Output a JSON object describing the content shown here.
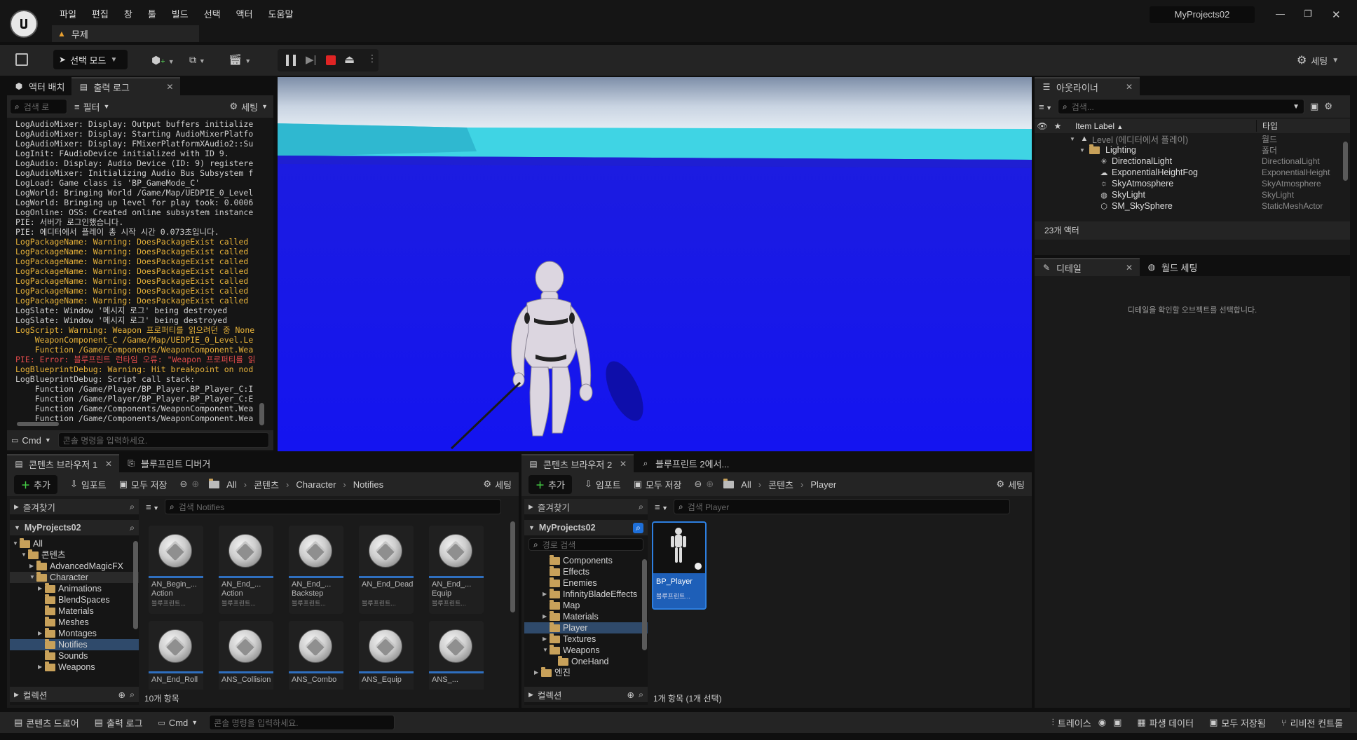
{
  "menubar": {
    "items": [
      "파일",
      "편집",
      "창",
      "툴",
      "빌드",
      "선택",
      "액터",
      "도움말"
    ],
    "project_name": "MyProjects02",
    "level_tab": "무제"
  },
  "toolbar": {
    "select_mode": "선택 모드",
    "settings": "세팅"
  },
  "left_panel": {
    "tabs": [
      "액터 배치",
      "출력 로그"
    ],
    "search_placeholder": "검색 로",
    "filter": "필터",
    "settings": "세팅",
    "cmd": "Cmd",
    "console_placeholder": "콘솔 명령을 입력하세요.",
    "log": [
      {
        "t": "LogAudioMixer: Display: Output buffers initialize",
        "c": "norm"
      },
      {
        "t": "LogAudioMixer: Display: Starting AudioMixerPlatfo",
        "c": "norm"
      },
      {
        "t": "LogAudioMixer: Display: FMixerPlatformXAudio2::Su",
        "c": "norm"
      },
      {
        "t": "LogInit: FAudioDevice initialized with ID 9.",
        "c": "norm"
      },
      {
        "t": "LogAudio: Display: Audio Device (ID: 9) registere",
        "c": "norm"
      },
      {
        "t": "LogAudioMixer: Initializing Audio Bus Subsystem f",
        "c": "norm"
      },
      {
        "t": "LogLoad: Game class is 'BP_GameMode_C'",
        "c": "norm"
      },
      {
        "t": "LogWorld: Bringing World /Game/Map/UEDPIE_0_Level",
        "c": "norm"
      },
      {
        "t": "LogWorld: Bringing up level for play took: 0.0006",
        "c": "norm"
      },
      {
        "t": "LogOnline: OSS: Created online subsystem instance",
        "c": "norm"
      },
      {
        "t": "PIE: 서버가 로그인했습니다.",
        "c": "norm"
      },
      {
        "t": "PIE: 에디터에서 플레이 총 시작 시간 0.073초입니다.",
        "c": "norm"
      },
      {
        "t": "LogPackageName: Warning: DoesPackageExist called",
        "c": "warn"
      },
      {
        "t": "LogPackageName: Warning: DoesPackageExist called",
        "c": "warn"
      },
      {
        "t": "LogPackageName: Warning: DoesPackageExist called",
        "c": "warn"
      },
      {
        "t": "LogPackageName: Warning: DoesPackageExist called",
        "c": "warn"
      },
      {
        "t": "LogPackageName: Warning: DoesPackageExist called",
        "c": "warn"
      },
      {
        "t": "LogPackageName: Warning: DoesPackageExist called",
        "c": "warn"
      },
      {
        "t": "LogPackageName: Warning: DoesPackageExist called",
        "c": "warn"
      },
      {
        "t": "LogSlate: Window '메시지 로그' being destroyed",
        "c": "norm"
      },
      {
        "t": "LogSlate: Window '메시지 로그' being destroyed",
        "c": "norm"
      },
      {
        "t": "LogScript: Warning: Weapon 프로퍼티를 읽으려던 중 None",
        "c": "warn"
      },
      {
        "t": "    WeaponComponent_C /Game/Map/UEDPIE_0_Level.Le",
        "c": "warn"
      },
      {
        "t": "    Function /Game/Components/WeaponComponent.Wea",
        "c": "warn"
      },
      {
        "t": "PIE: Error: 블루프린트 런타임 오류: \"Weapon 프로퍼티를 읽",
        "c": "err"
      },
      {
        "t": "LogBlueprintDebug: Warning: Hit breakpoint on nod",
        "c": "warn"
      },
      {
        "t": "LogBlueprintDebug: Script call stack:",
        "c": "norm"
      },
      {
        "t": "    Function /Game/Player/BP_Player.BP_Player_C:I",
        "c": "norm"
      },
      {
        "t": "    Function /Game/Player/BP_Player.BP_Player_C:E",
        "c": "norm"
      },
      {
        "t": "    Function /Game/Components/WeaponComponent.Wea",
        "c": "norm"
      },
      {
        "t": "    Function /Game/Components/WeaponComponent.Wea",
        "c": "norm"
      }
    ]
  },
  "outliner": {
    "tab": "아웃라이너",
    "search_placeholder": "검색...",
    "col_label": "Item Label",
    "col_type": "타입",
    "rows": [
      {
        "label": "Level (에디터에서 플레이)",
        "type": "월드",
        "indent": 0,
        "kind": "level"
      },
      {
        "label": "Lighting",
        "type": "폴더",
        "indent": 1,
        "kind": "folder"
      },
      {
        "label": "DirectionalLight",
        "type": "DirectionalLight",
        "indent": 2,
        "kind": "light"
      },
      {
        "label": "ExponentialHeightFog",
        "type": "ExponentialHeight",
        "indent": 2,
        "kind": "fog"
      },
      {
        "label": "SkyAtmosphere",
        "type": "SkyAtmosphere",
        "indent": 2,
        "kind": "sky"
      },
      {
        "label": "SkyLight",
        "type": "SkyLight",
        "indent": 2,
        "kind": "skylight"
      },
      {
        "label": "SM_SkySphere",
        "type": "StaticMeshActor",
        "indent": 2,
        "kind": "mesh"
      }
    ],
    "count": "23개 액터"
  },
  "details": {
    "tab": "디테일",
    "tab2": "월드 세팅",
    "empty_msg": "디테일을 확인할 오브젝트를 선택합니다."
  },
  "cb1": {
    "tab": "콘텐츠 브라우저 1",
    "tab2": "블루프린트 디버거",
    "add": "추가",
    "import": "임포트",
    "save_all": "모두 저장",
    "path": [
      "All",
      "콘텐츠",
      "Character",
      "Notifies"
    ],
    "settings": "세팅",
    "favorites": "즐겨찾기",
    "project": "MyProjects02",
    "tree": [
      {
        "label": "All",
        "indent": 0,
        "open": true
      },
      {
        "label": "콘텐츠",
        "indent": 1,
        "open": true
      },
      {
        "label": "AdvancedMagicFX",
        "indent": 2,
        "arrow": true
      },
      {
        "label": "Character",
        "indent": 2,
        "open": true,
        "hl": true
      },
      {
        "label": "Animations",
        "indent": 3,
        "arrow": true
      },
      {
        "label": "BlendSpaces",
        "indent": 3
      },
      {
        "label": "Materials",
        "indent": 3
      },
      {
        "label": "Meshes",
        "indent": 3
      },
      {
        "label": "Montages",
        "indent": 3,
        "arrow": true
      },
      {
        "label": "Notifies",
        "indent": 3,
        "sel": true
      },
      {
        "label": "Sounds",
        "indent": 3
      },
      {
        "label": "Weapons",
        "indent": 3,
        "arrow": true
      }
    ],
    "collections": "컬렉션",
    "search_placeholder": "검색 Notifies",
    "assets": [
      {
        "name": "AN_Begin_...\nAction",
        "type": "블루프린트..."
      },
      {
        "name": "AN_End_...\nAction",
        "type": "블루프린트..."
      },
      {
        "name": "AN_End_...\nBackstep",
        "type": "블루프린트..."
      },
      {
        "name": "AN_End_Dead",
        "type": "블루프린트..."
      },
      {
        "name": "AN_End_...\nEquip",
        "type": "블루프린트..."
      },
      {
        "name": "AN_End_Roll",
        "type": ""
      },
      {
        "name": "ANS_Collision",
        "type": ""
      },
      {
        "name": "ANS_Combo",
        "type": ""
      },
      {
        "name": "ANS_Equip",
        "type": ""
      },
      {
        "name": "ANS_...",
        "type": ""
      }
    ],
    "item_count": "10개 항목"
  },
  "cb2": {
    "tab": "콘텐츠 브라우저 2",
    "tab2": "블루프린트 2에서...",
    "add": "추가",
    "import": "임포트",
    "save_all": "모두 저장",
    "path": [
      "All",
      "콘텐츠",
      "Player"
    ],
    "settings": "세팅",
    "favorites": "즐겨찾기",
    "project": "MyProjects02",
    "path_search": "경로 검색",
    "tree": [
      {
        "label": "Components",
        "indent": 1
      },
      {
        "label": "Effects",
        "indent": 1
      },
      {
        "label": "Enemies",
        "indent": 1
      },
      {
        "label": "InfinityBladeEffects",
        "indent": 1,
        "arrow": true
      },
      {
        "label": "Map",
        "indent": 1
      },
      {
        "label": "Materials",
        "indent": 1,
        "arrow": true
      },
      {
        "label": "Player",
        "indent": 1,
        "sel": true
      },
      {
        "label": "Textures",
        "indent": 1,
        "arrow": true
      },
      {
        "label": "Weapons",
        "indent": 1,
        "open": true
      },
      {
        "label": "OneHand",
        "indent": 2
      },
      {
        "label": "엔진",
        "indent": 0,
        "arrow": true
      }
    ],
    "collections": "컬렉션",
    "search_placeholder": "검색 Player",
    "asset": {
      "name": "BP_Player",
      "type": "블루프린트..."
    },
    "item_count": "1개 항목 (1개 선택)"
  },
  "statusbar": {
    "content_drawer": "콘텐츠 드로어",
    "output_log": "출력 로그",
    "cmd": "Cmd",
    "console_placeholder": "콘솔 명령을 입력하세요.",
    "trace": "트레이스",
    "derived_data": "파생 데이터",
    "save_all": "모두 저장됨",
    "revision": "리비전 컨트롤"
  }
}
